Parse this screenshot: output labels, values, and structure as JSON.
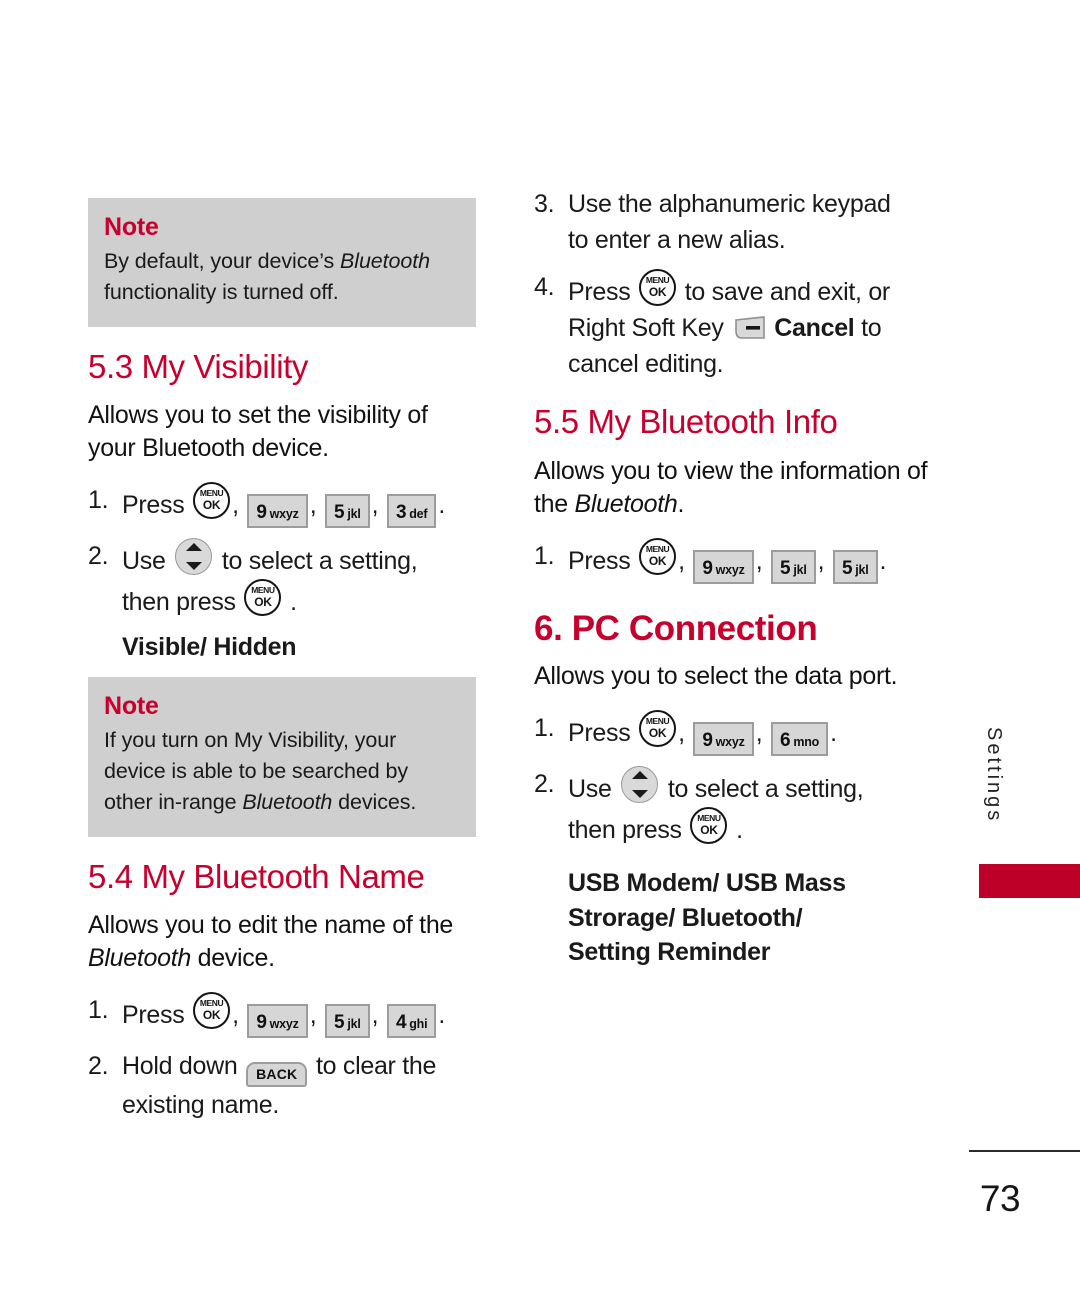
{
  "document": {
    "page_number": "73",
    "side_tab_label": "Settings",
    "accent_color": "#c8002e",
    "tab_color": "#be0028",
    "note_bg_color": "#cfcfcf"
  },
  "left_column": {
    "note_1": {
      "title": "Note",
      "text_before_italic": "By default, your device’s ",
      "italic_word": "Bluetooth",
      "text_after_italic": " functionality is turned off."
    },
    "section_5_3": {
      "heading": "5.3 My Visibility",
      "description": "Allows you to set the visibility of your Bluetooth device.",
      "step_1": {
        "num": "1.",
        "lead": "Press",
        "keys": [
          {
            "type": "menu-ok",
            "line1": "MENU",
            "line2": "OK"
          },
          {
            "type": "sep",
            "label": ","
          },
          {
            "type": "numkey",
            "digit": "9",
            "letters": "wxyz"
          },
          {
            "type": "sep",
            "label": ","
          },
          {
            "type": "numkey",
            "digit": "5",
            "letters": "jkl"
          },
          {
            "type": "sep",
            "label": ","
          },
          {
            "type": "numkey",
            "digit": "3",
            "letters": "def"
          },
          {
            "type": "sep",
            "label": "."
          }
        ]
      },
      "step_2": {
        "num": "2.",
        "lead": "Use",
        "nav_key": "navigation-up-down",
        "mid": "to select a setting,",
        "cont_lead": "then press",
        "cont_key": {
          "line1": "MENU",
          "line2": "OK"
        },
        "cont_tail": "."
      },
      "options": "Visible/ Hidden"
    },
    "note_2": {
      "title": "Note",
      "text_before_italic": "If you turn on My Visibility, your device is able to be searched by other in-range ",
      "italic_word": "Bluetooth",
      "text_after_italic": " devices."
    },
    "section_5_4": {
      "heading": "5.4 My Bluetooth Name",
      "description_before_italic": "Allows you to edit the name of the ",
      "description_italic": "Bluetooth",
      "description_after_italic": " device.",
      "step_1": {
        "num": "1.",
        "lead": "Press",
        "keys": [
          {
            "type": "menu-ok",
            "line1": "MENU",
            "line2": "OK"
          },
          {
            "type": "sep",
            "label": ","
          },
          {
            "type": "numkey",
            "digit": "9",
            "letters": "wxyz"
          },
          {
            "type": "sep",
            "label": ","
          },
          {
            "type": "numkey",
            "digit": "5",
            "letters": "jkl"
          },
          {
            "type": "sep",
            "label": ","
          },
          {
            "type": "numkey",
            "digit": "4",
            "letters": "ghi"
          },
          {
            "type": "sep",
            "label": "."
          }
        ]
      },
      "step_2": {
        "num": "2.",
        "lead": "Hold down",
        "back_key": "BACK",
        "mid": "to clear the",
        "cont": "existing name."
      }
    }
  },
  "right_column": {
    "step_3": {
      "num": "3.",
      "line_1": "Use the alphanumeric keypad",
      "line_2": "to enter a new alias."
    },
    "step_4": {
      "num": "4.",
      "lead": "Press",
      "menu_key": {
        "line1": "MENU",
        "line2": "OK"
      },
      "mid": "to save and exit, or",
      "cont_lead": "Right Soft Key",
      "soft_key": "right-soft-key",
      "cont_bold": "Cancel",
      "cont_tail": "to",
      "cont_line3": "cancel editing."
    },
    "section_5_5": {
      "heading": "5.5 My Bluetooth Info",
      "description_before_italic": "Allows you to view the information of the ",
      "description_italic": "Bluetooth",
      "description_after_italic": ".",
      "step_1": {
        "num": "1.",
        "lead": "Press",
        "keys": [
          {
            "type": "menu-ok",
            "line1": "MENU",
            "line2": "OK"
          },
          {
            "type": "sep",
            "label": ","
          },
          {
            "type": "numkey",
            "digit": "9",
            "letters": "wxyz"
          },
          {
            "type": "sep",
            "label": ","
          },
          {
            "type": "numkey",
            "digit": "5",
            "letters": "jkl"
          },
          {
            "type": "sep",
            "label": ","
          },
          {
            "type": "numkey",
            "digit": "5",
            "letters": "jkl"
          },
          {
            "type": "sep",
            "label": "."
          }
        ]
      }
    },
    "section_6": {
      "heading": "6. PC Connection",
      "description": "Allows you to select the data port.",
      "step_1": {
        "num": "1.",
        "lead": "Press",
        "keys": [
          {
            "type": "menu-ok",
            "line1": "MENU",
            "line2": "OK"
          },
          {
            "type": "sep",
            "label": ","
          },
          {
            "type": "numkey",
            "digit": "9",
            "letters": "wxyz"
          },
          {
            "type": "sep",
            "label": ","
          },
          {
            "type": "numkey",
            "digit": "6",
            "letters": "mno"
          },
          {
            "type": "sep",
            "label": "."
          }
        ]
      },
      "step_2": {
        "num": "2.",
        "lead": "Use",
        "nav_key": "navigation-up-down",
        "mid": "to select a setting,",
        "cont_lead": "then press",
        "cont_key": {
          "line1": "MENU",
          "line2": "OK"
        },
        "cont_tail": "."
      },
      "options_line_1": "USB Modem/ USB Mass",
      "options_line_2": "Strorage/ Bluetooth/",
      "options_line_3": "Setting Reminder"
    }
  }
}
